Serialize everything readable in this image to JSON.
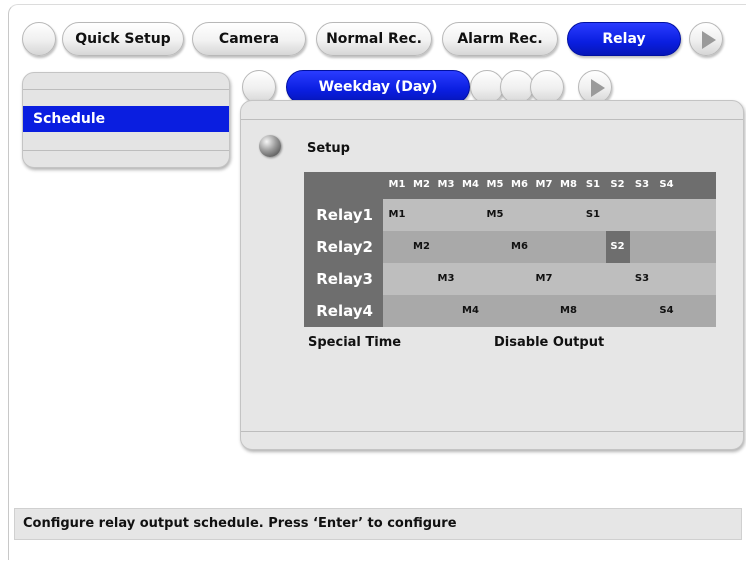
{
  "top_tabs": [
    {
      "label": "Quick Setup",
      "active": false
    },
    {
      "label": "Camera",
      "active": false
    },
    {
      "label": "Normal Rec.",
      "active": false
    },
    {
      "label": "Alarm Rec.",
      "active": false
    },
    {
      "label": "Relay",
      "active": true
    }
  ],
  "sidebar": {
    "items": [
      {
        "label": "Schedule",
        "selected": true
      }
    ]
  },
  "sub_tabs": [
    {
      "label": "Weekday (Day)",
      "active": true
    }
  ],
  "section": {
    "title": "Setup"
  },
  "schedule": {
    "columns": [
      "M1",
      "M2",
      "M3",
      "M4",
      "M5",
      "M6",
      "M7",
      "M8",
      "S1",
      "S2",
      "S3",
      "S4"
    ],
    "rows": [
      {
        "label": "Relay1",
        "cells": [
          "M1",
          "",
          "",
          "",
          "M5",
          "",
          "",
          "",
          "S1",
          "",
          "",
          ""
        ],
        "special": []
      },
      {
        "label": "Relay2",
        "cells": [
          "",
          "M2",
          "",
          "",
          "",
          "M6",
          "",
          "",
          "",
          "S2",
          "",
          ""
        ],
        "special": [
          9
        ]
      },
      {
        "label": "Relay3",
        "cells": [
          "",
          "",
          "M3",
          "",
          "",
          "",
          "M7",
          "",
          "",
          "",
          "S3",
          ""
        ],
        "special": []
      },
      {
        "label": "Relay4",
        "cells": [
          "",
          "",
          "",
          "M4",
          "",
          "",
          "",
          "M8",
          "",
          "",
          "",
          "S4"
        ],
        "special": []
      }
    ]
  },
  "legend": {
    "special_time": "Special Time",
    "disable_output": "Disable Output"
  },
  "status_bar": {
    "text": "Configure relay output schedule. Press ‘Enter’ to configure"
  },
  "colors": {
    "accent": "#0a1ee0",
    "grid_dark": "#6e6e6e",
    "panel": "#e6e6e6"
  }
}
